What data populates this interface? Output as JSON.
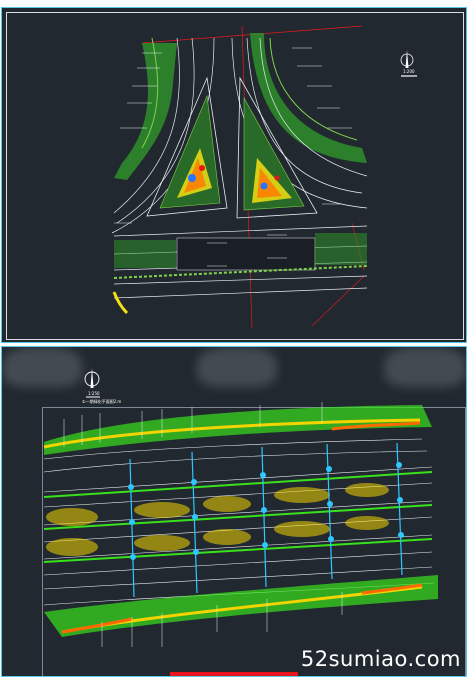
{
  "top_sheet": {
    "scale_text": "1:200",
    "colors": {
      "background": "#212830",
      "border": "#56c7e6",
      "planting": "#3aa832",
      "road_line": "#e8eef2",
      "red_line": "#e21a1a",
      "accent_orange": "#ff7a00",
      "accent_yellow": "#f2e013",
      "accent_blue": "#2a73ff"
    }
  },
  "bottom_sheet": {
    "scale_text": "1:250",
    "subtitle": "①一期绿化平面图2.m",
    "colors": {
      "background": "#212830",
      "hedge": "#39e11c",
      "yellow_band": "#f3d400",
      "orange_band": "#ff6a00",
      "cyan_nodes": "#2ec7ff"
    }
  },
  "icons": {
    "north_arrow": "north-arrow-icon",
    "blur_patch": "privacy-blur"
  },
  "watermark": "52sumiao.com"
}
